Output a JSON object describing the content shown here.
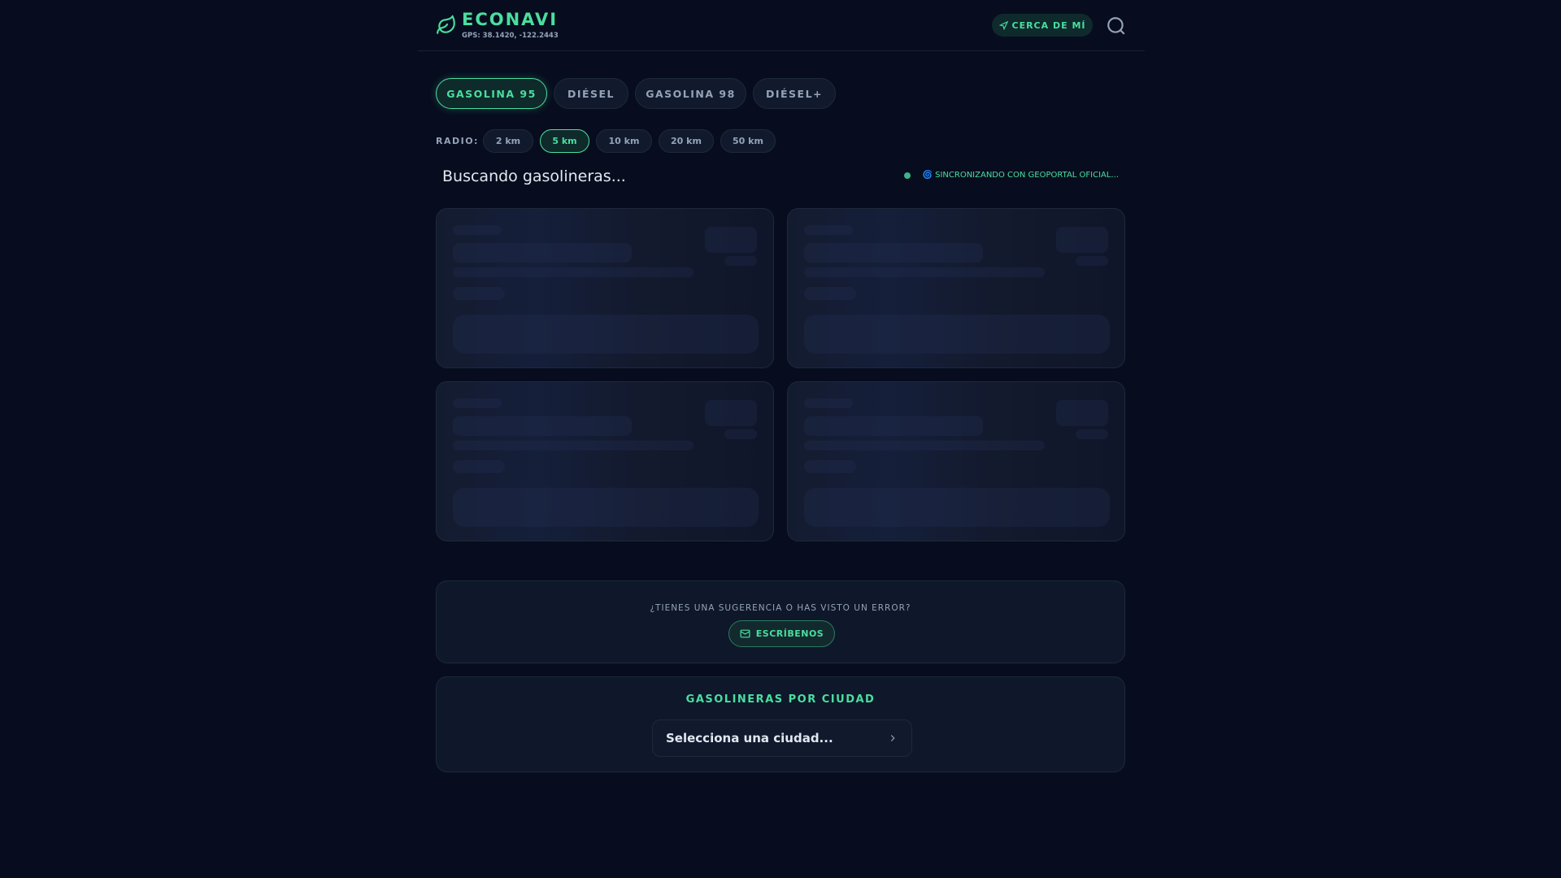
{
  "header": {
    "brand": "ECONAVI",
    "gps": "GPS: 38.1420, -122.2443",
    "near_me": "CERCA DE MÍ"
  },
  "fuel_tabs": [
    {
      "label": "GASOLINA 95",
      "active": true
    },
    {
      "label": "DIÉSEL"
    },
    {
      "label": "GASOLINA 98"
    },
    {
      "label": "DIÉSEL+"
    }
  ],
  "radius": {
    "label": "RADIO:",
    "options": [
      "2 km",
      "5 km",
      "10 km",
      "20 km",
      "50 km"
    ],
    "selected": "5 km"
  },
  "status": {
    "title": "Buscando gasolineras...",
    "sync": "🌀 SINCRONIZANDO CON GEOPORTAL OFICIAL..."
  },
  "feedback": {
    "question": "¿TIENES UNA SUGERENCIA O HAS VISTO UN ERROR?",
    "button": "ESCRÍBENOS"
  },
  "cities": {
    "title": "GASOLINERAS POR CIUDAD",
    "placeholder": "Selecciona una ciudad..."
  },
  "colors": {
    "accent": "#4ade9f",
    "background": "#070d1e"
  }
}
